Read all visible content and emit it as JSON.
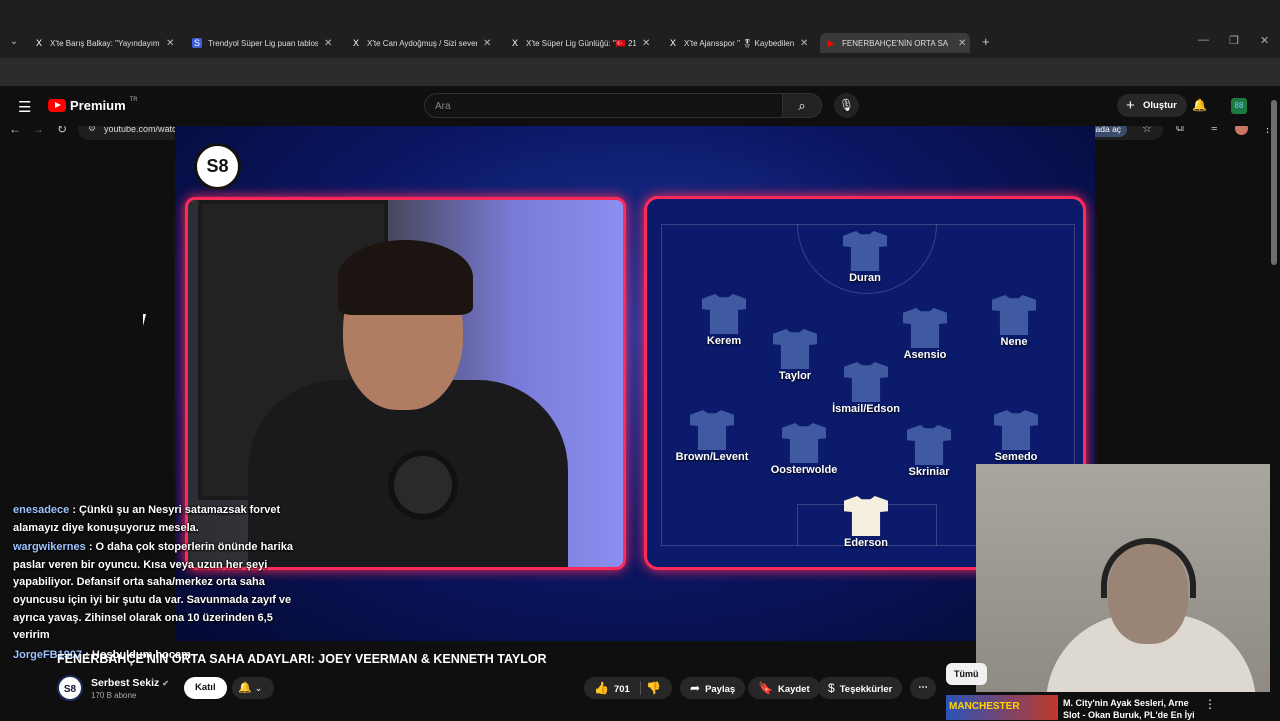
{
  "browser": {
    "tabs": [
      {
        "icon": "X",
        "title": "X'te Barış Balkay: \"Yayındayım. I"
      },
      {
        "icon": "S",
        "title": "Trendyol Süper Lig puan tablos"
      },
      {
        "icon": "X",
        "title": "X'te Can Aydoğmuş / Sizi sever"
      },
      {
        "icon": "X",
        "title": "X'te Süper Lig Günlüğü: \"🇹🇷 21"
      },
      {
        "icon": "X",
        "title": "X'te Ajansspor \" 🎖 Kaybedilen"
      },
      {
        "icon": "▶",
        "title": "FENERBAHÇE'NİN ORTA SA"
      }
    ],
    "url": "youtube.com/watch?v=veKwlBctQQw",
    "open_in_app": "Uygulamada aç"
  },
  "youtube": {
    "logo_text": "Premium",
    "logo_sup": "TR",
    "search_placeholder": "Ara",
    "create_label": "Oluştur",
    "avatar_text": "88"
  },
  "video": {
    "channel_logo": "S8",
    "formation": [
      {
        "name": "Duran"
      },
      {
        "name": "Kerem"
      },
      {
        "name": "Asensio"
      },
      {
        "name": "Nene"
      },
      {
        "name": "Taylor"
      },
      {
        "name": "İsmail/Edson"
      },
      {
        "name": "Brown/Levent"
      },
      {
        "name": "Oosterwolde"
      },
      {
        "name": "Skriniar"
      },
      {
        "name": "Semedo"
      },
      {
        "name": "Ederson"
      }
    ]
  },
  "chat": [
    {
      "user": "enesadece",
      "text": ": Çünkü şu an Nesyri satamazsak forvet alamayız diye konuşuyoruz mesela."
    },
    {
      "user": "wargwikernes",
      "text": ": O daha çok stoperlerin önünde harika paslar veren bir oyuncu. Kısa veya uzun her şeyi yapabiliyor. Defansif orta saha/merkez orta saha oyuncusu için iyi bir şutu da var. Savunmada zayıf ve ayrıca yavaş. Zihinsel olarak ona 10 üzerinden 6,5 veririm"
    },
    {
      "user": "JorgeFB1907",
      "text": ": Hoşbuldum hocam"
    }
  ],
  "meta": {
    "title": "FENERBAHÇE'NİN ORTA SAHA ADAYLARI: JOEY VEERMAN & KENNETH TAYLOR",
    "channel_name": "Serbest Sekiz",
    "verified": "✔",
    "subscribers": "170 B abone",
    "join_label": "Katıl",
    "like_count": "701",
    "share_label": "Paylaş",
    "save_label": "Kaydet",
    "thanks_label": "Teşekkürler",
    "filter_label": "Tümü"
  },
  "recommendation": {
    "thumb_label": "MANCHESTER",
    "title": "M. City'nin Ayak Sesleri, Arne Slot - Okan Buruk, PL'de En İyi"
  }
}
